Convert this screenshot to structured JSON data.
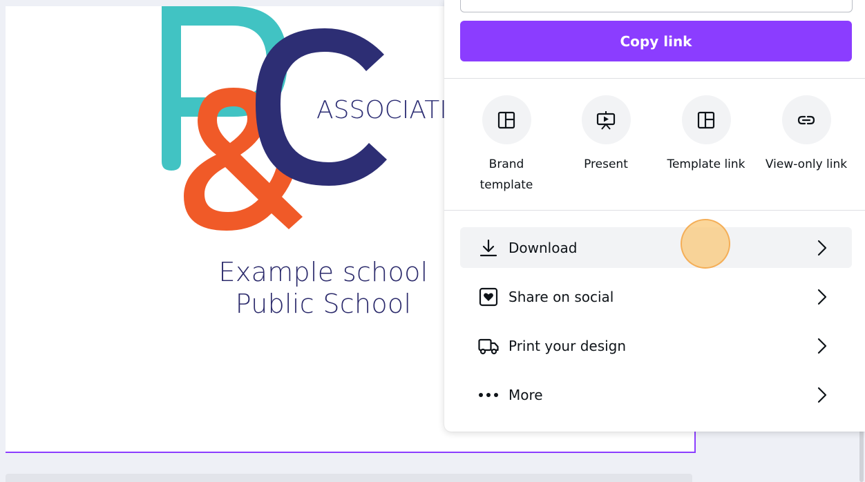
{
  "canvas": {
    "logo": {
      "letters": "P&C",
      "word": "ASSOCIATIO",
      "colors": {
        "p": "#41c3c3",
        "ampersand": "#f05a28",
        "c": "#2d2e74"
      }
    },
    "school_line1": "Example school",
    "school_line2": "Public School"
  },
  "share_panel": {
    "copy_link_label": "Copy link",
    "accent_color": "#8b3dff",
    "quick_actions": [
      {
        "label": "Brand template",
        "icon": "brand-template-icon"
      },
      {
        "label": "Present",
        "icon": "present-icon"
      },
      {
        "label": "Template link",
        "icon": "template-link-icon"
      },
      {
        "label": "View-only link",
        "icon": "link-icon"
      }
    ],
    "menu": [
      {
        "label": "Download",
        "icon": "download-icon"
      },
      {
        "label": "Share on social",
        "icon": "heart-icon"
      },
      {
        "label": "Print your design",
        "icon": "truck-icon"
      },
      {
        "label": "More",
        "icon": "more-dots-icon"
      }
    ]
  }
}
